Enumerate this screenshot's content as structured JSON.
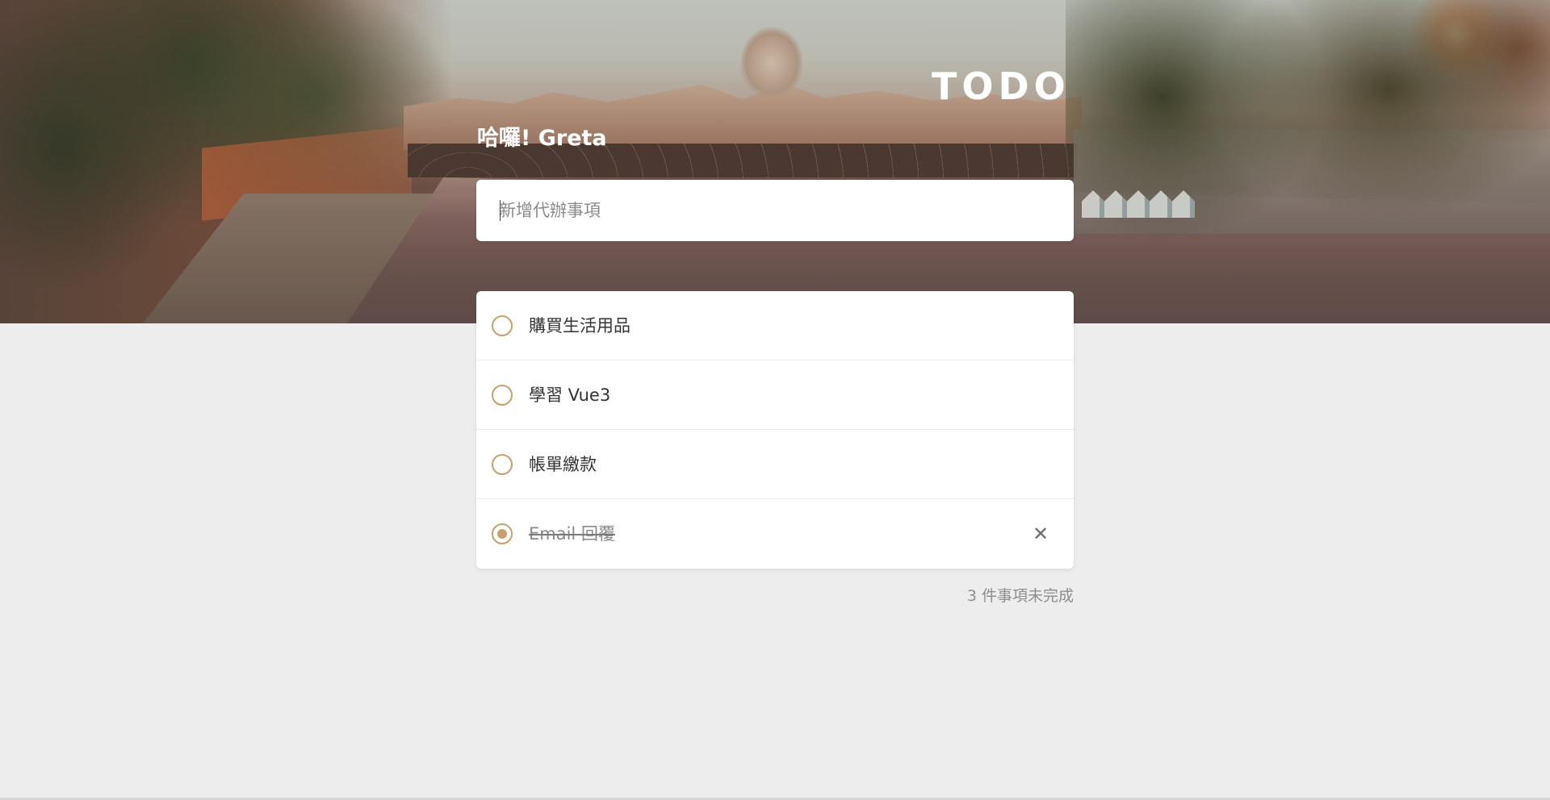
{
  "header": {
    "brand": "TODO",
    "greeting": "哈囉! Greta"
  },
  "new_todo": {
    "placeholder": "新增代辦事項",
    "value": ""
  },
  "todos": [
    {
      "label": "購買生活用品",
      "completed": false
    },
    {
      "label": "學習 Vue3",
      "completed": false
    },
    {
      "label": "帳單繳款",
      "completed": false
    },
    {
      "label": "Email 回覆",
      "completed": true
    }
  ],
  "footer": {
    "remaining_text": "3 件事項未完成"
  },
  "icons": {
    "delete": "close-icon"
  },
  "colors": {
    "accent": "#c9a06d",
    "background": "#ededed",
    "card": "#ffffff"
  }
}
